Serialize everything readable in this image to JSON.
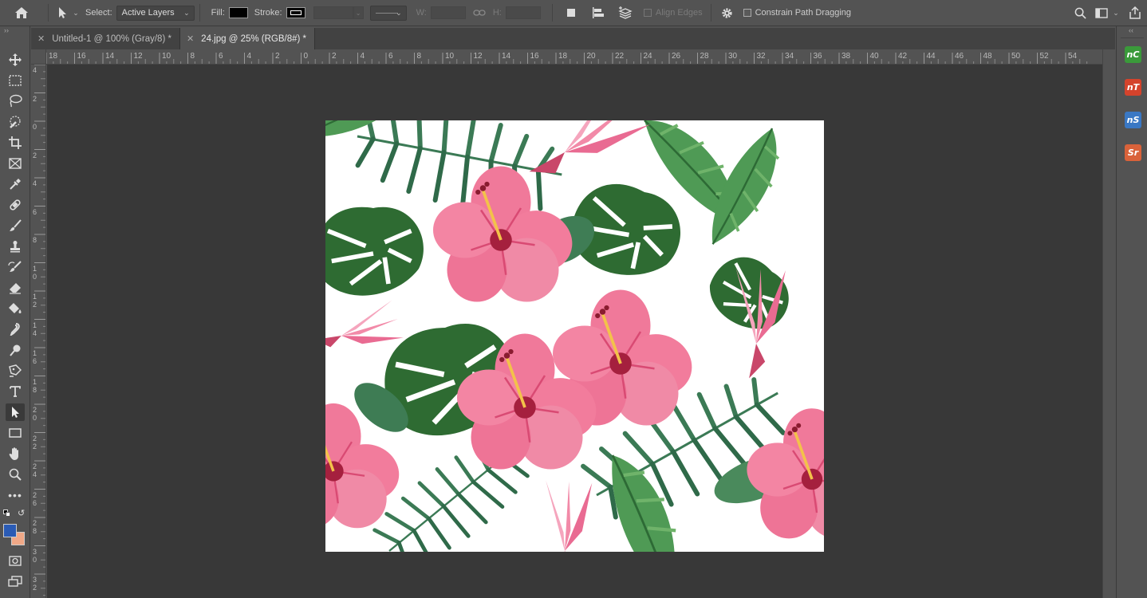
{
  "options_bar": {
    "select_label": "Select:",
    "select_value": "Active Layers",
    "fill_label": "Fill:",
    "stroke_label": "Stroke:",
    "w_label": "W:",
    "h_label": "H:",
    "align_edges_label": "Align Edges",
    "constrain_label": "Constrain Path Dragging",
    "fill_color": "#000000"
  },
  "tabs": [
    {
      "label": "Untitled-1 @ 100% (Gray/8) *"
    },
    {
      "label": "24.jpg @ 25% (RGB/8#) *"
    }
  ],
  "ruler_top": [
    "18",
    "16",
    "14",
    "12",
    "10",
    "8",
    "6",
    "4",
    "2",
    "0",
    "2",
    "4",
    "6",
    "8",
    "10",
    "12",
    "14",
    "16",
    "18",
    "20",
    "22",
    "24",
    "26",
    "28",
    "30",
    "32",
    "34",
    "36",
    "38",
    "40",
    "42",
    "44",
    "46",
    "48",
    "50",
    "52",
    "54"
  ],
  "ruler_left": [
    "4",
    "2",
    "0",
    "2",
    "4",
    "6",
    "8",
    "1\n0",
    "1\n2",
    "1\n4",
    "1\n6",
    "1\n8",
    "2\n0",
    "2\n2",
    "2\n4",
    "2\n6",
    "2\n8",
    "3\n0",
    "3\n2"
  ],
  "plugins": [
    {
      "label": "nC",
      "color": "#3a9a3a"
    },
    {
      "label": "nT",
      "color": "#d4432c"
    },
    {
      "label": "nS",
      "color": "#3a78c4"
    },
    {
      "label": "Sr",
      "color": "#d9623a"
    }
  ],
  "colors": {
    "foreground": "#2a5bb5",
    "background": "#f0a887"
  }
}
